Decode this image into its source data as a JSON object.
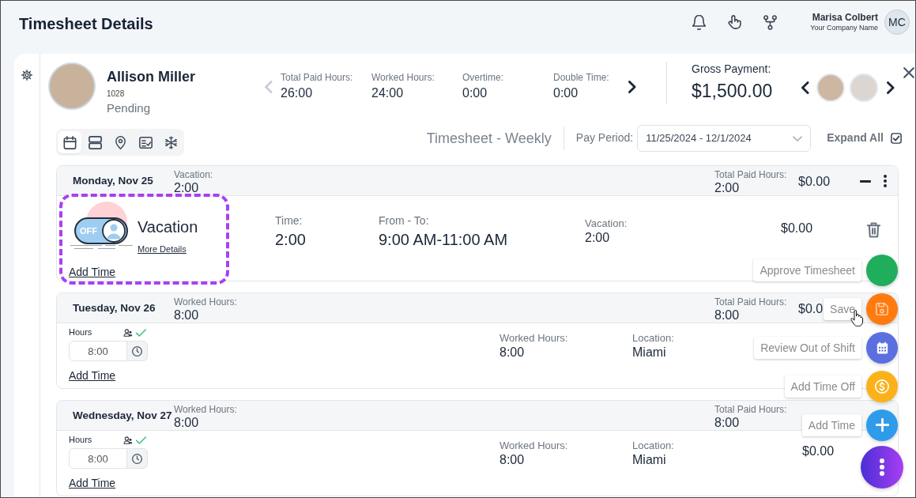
{
  "header": {
    "title": "Timesheet Details",
    "user_name": "Marisa Colbert",
    "company": "Your Company Name",
    "initials": "MC"
  },
  "employee": {
    "name": "Allison Miller",
    "id": "1028",
    "status": "Pending"
  },
  "stats_nav": [
    {
      "kind": "prev",
      "disabled": true
    },
    {
      "kind": "next",
      "disabled": false
    }
  ],
  "stats": [
    {
      "label": "Total Paid Hours:",
      "value": "26:00"
    },
    {
      "label": "Worked Hours:",
      "value": "24:00"
    },
    {
      "label": "Overtime:",
      "value": "0:00"
    },
    {
      "label": "Double Time:",
      "value": "0:00"
    }
  ],
  "gross_payment": {
    "label": "Gross Payment:",
    "value": "$1,500.00"
  },
  "view_tools": [
    {
      "kind": "calendar",
      "selected": true
    },
    {
      "kind": "rows",
      "selected": false
    },
    {
      "kind": "location",
      "selected": false
    },
    {
      "kind": "report",
      "selected": false
    },
    {
      "kind": "snowflake",
      "selected": false
    }
  ],
  "view_title": "Timesheet - Weekly",
  "pay_period": {
    "label": "Pay Period:",
    "value": "11/25/2024 - 12/1/2024"
  },
  "expand_all": {
    "label": "Expand All",
    "checked": true
  },
  "days": [
    {
      "date": "Monday, Nov 25",
      "summary_label": "Vacation:",
      "summary_value": "2:00",
      "total_label": "Total Paid Hours:",
      "total_value": "2:00",
      "amount": "$0.00",
      "expanded": true,
      "menu": true,
      "entry": {
        "kind": "time_off",
        "title": "Vacation",
        "toggle_label": "OFF",
        "link": "More Details",
        "add_label": "Add Time",
        "highlighted": true,
        "deletable": true,
        "fields": [
          {
            "kind": "main",
            "label": "Time:",
            "value": "2:00"
          },
          {
            "kind": "main",
            "label": "From - To:",
            "value": "9:00 AM-11:00 AM"
          },
          {
            "kind": "detail",
            "label": "Vacation:",
            "value": "2:00"
          }
        ],
        "amount": "$0.00"
      }
    },
    {
      "date": "Tuesday, Nov 26",
      "summary_label": "Worked Hours:",
      "summary_value": "8:00",
      "total_label": "Total Paid Hours:",
      "total_value": "8:00",
      "amount": "$0.0",
      "entry": {
        "kind": "hours",
        "hours_label": "Hours",
        "hours_value": "8:00",
        "approved": true,
        "add_label": "Add Time",
        "fields": [
          {
            "kind": "detail",
            "label": "Worked Hours:",
            "value": "8:00"
          },
          {
            "kind": "detail",
            "label": "Location:",
            "value": "Miami"
          }
        ]
      }
    },
    {
      "date": "Wednesday, Nov 27",
      "summary_label": "Worked Hours:",
      "summary_value": "8:00",
      "total_label": "Total Paid Hours:",
      "total_value": "8:00",
      "entry": {
        "kind": "hours",
        "hours_label": "Hours",
        "hours_value": "8:00",
        "approved": true,
        "add_label": "Add Time",
        "fields": [
          {
            "kind": "detail",
            "label": "Worked Hours:",
            "value": "8:00"
          },
          {
            "kind": "detail",
            "label": "Location:",
            "value": "Miami"
          }
        ],
        "amount": "$0.00"
      }
    }
  ],
  "actions": [
    {
      "kind": "approve",
      "label": "Approve Timesheet",
      "color": "#1fae5b",
      "hovered": false
    },
    {
      "kind": "save",
      "label": "Save",
      "color": "#ff7b0f",
      "hovered": true
    },
    {
      "kind": "schedule",
      "label": "Review Out of Shift",
      "color": "#5b6fe0",
      "hovered": false
    },
    {
      "kind": "time_off",
      "label": "Add Time Off",
      "color": "#fbb21a",
      "hovered": false
    },
    {
      "kind": "add",
      "label": "Add Time",
      "color": "#2f9beb",
      "hovered": false
    },
    {
      "kind": "menu"
    }
  ]
}
